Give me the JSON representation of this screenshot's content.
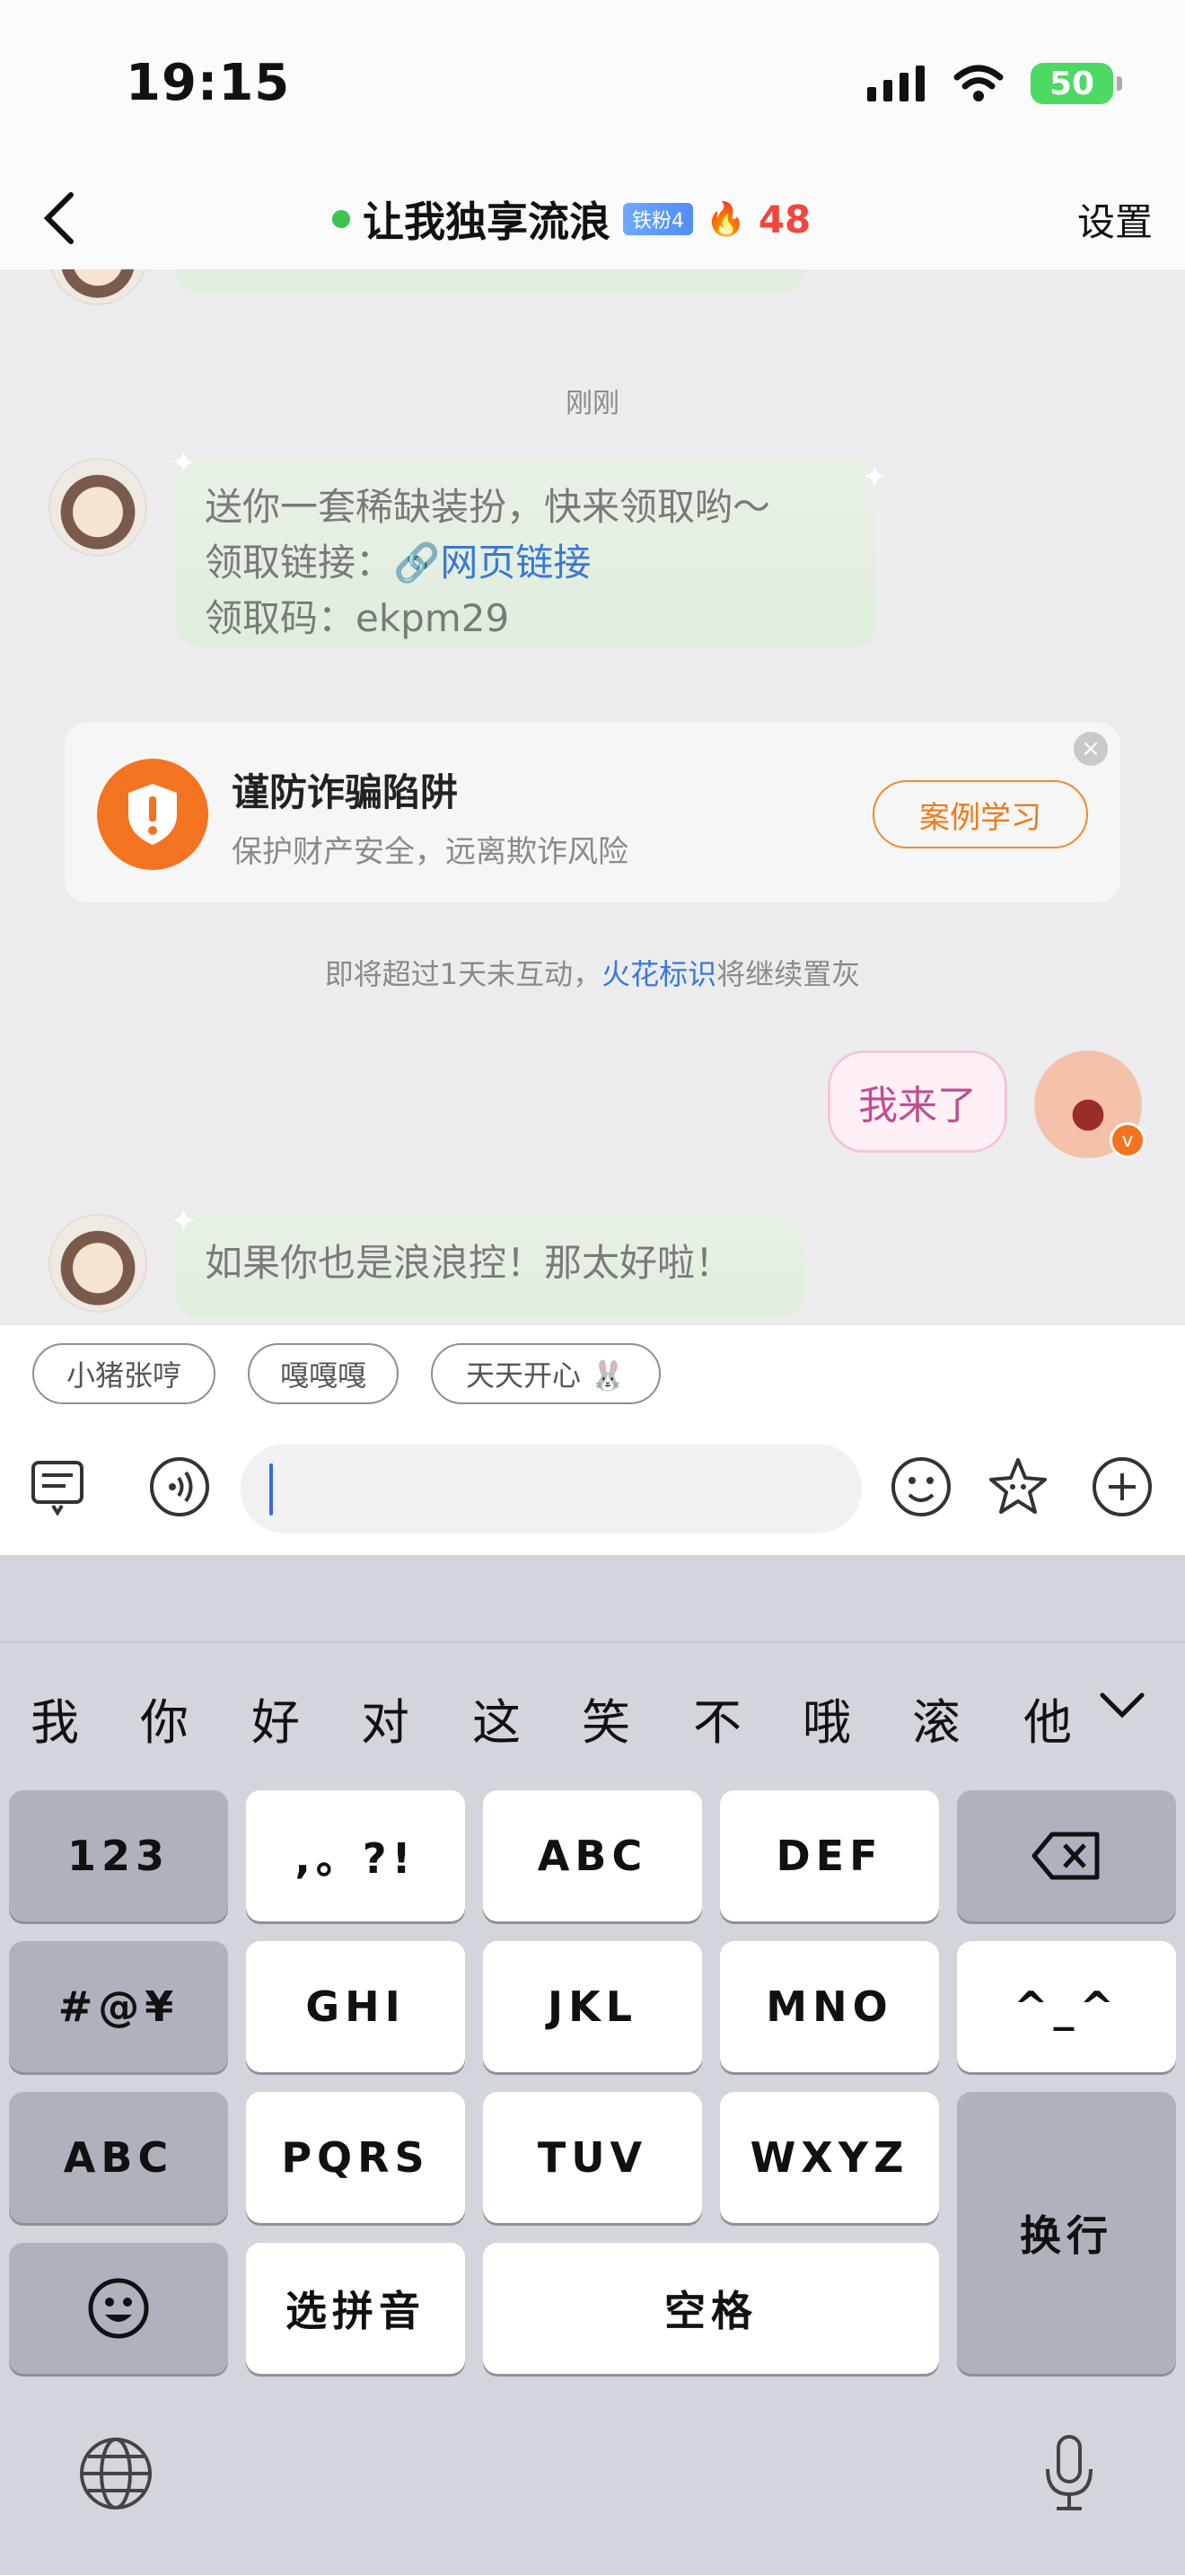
{
  "status": {
    "time": "19:15",
    "battery": "50"
  },
  "header": {
    "title": "让我独享流浪",
    "fan_badge": "铁粉4",
    "fire_count": "48",
    "settings": "设置"
  },
  "chat": {
    "timestamp": "刚刚",
    "msg1": {
      "line1": "送你一套稀缺装扮，快来领取哟～",
      "line2_prefix": "领取链接：",
      "link_text": "网页链接",
      "line3": "领取码：ekpm29"
    },
    "warn": {
      "title": "谨防诈骗陷阱",
      "subtitle": "保护财产安全，远离欺诈风险",
      "button": "案例学习"
    },
    "spark_notice": {
      "prefix": "即将超过1天未互动，",
      "link": "火花标识",
      "suffix": "将继续置灰"
    },
    "my_msg": "我来了",
    "msg2": "如果你也是浪浪控！那太好啦！"
  },
  "quick_replies": [
    "小猪张哼",
    "嘎嘎嘎",
    "天天开心 🐰"
  ],
  "keyboard": {
    "candidates": [
      "我",
      "你",
      "好",
      "对",
      "这",
      "笑",
      "不",
      "哦",
      "滚",
      "他"
    ],
    "keys": {
      "num": "123",
      "punct": ",。?!",
      "abc": "ABC",
      "def": "DEF",
      "symbols": "#@¥",
      "ghi": "GHI",
      "jkl": "JKL",
      "mno": "MNO",
      "emoticon": "^_^",
      "abc_switch": "ABC",
      "pqrs": "PQRS",
      "tuv": "TUV",
      "wxyz": "WXYZ",
      "pinyin": "选拼音",
      "space": "空格",
      "return": "换行"
    }
  }
}
